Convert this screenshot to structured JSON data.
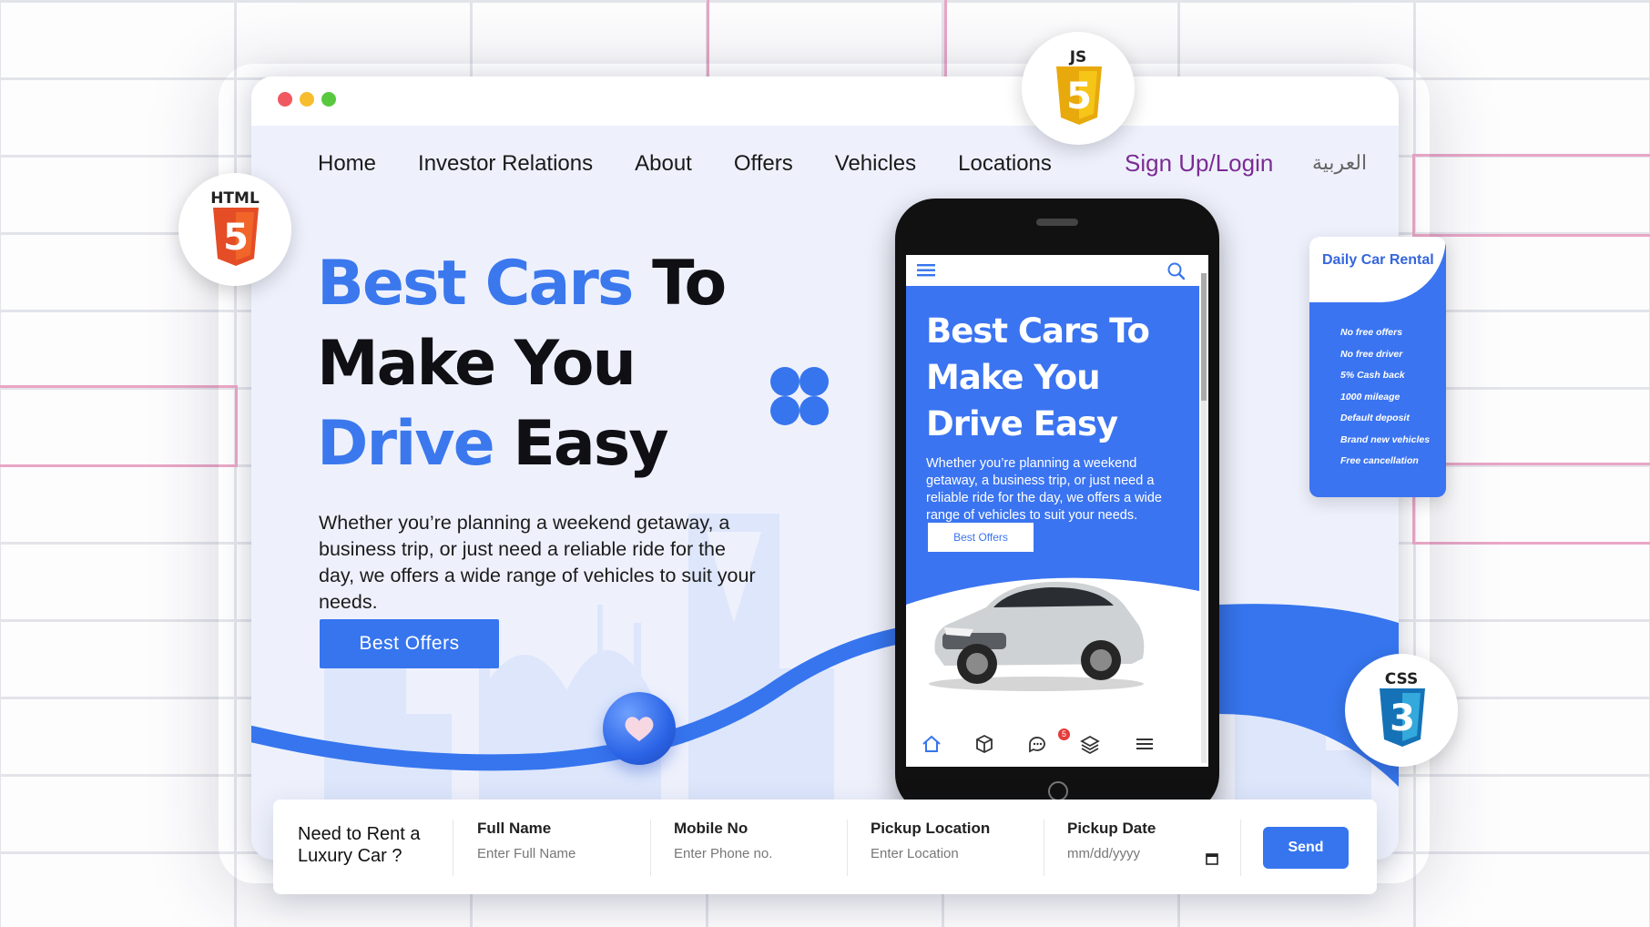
{
  "nav": {
    "items": [
      "Home",
      "Investor Relations",
      "About",
      "Offers",
      "Vehicles",
      "Locations"
    ],
    "signup": "Sign Up/Login",
    "language": "العربية"
  },
  "hero": {
    "line1_blue": "Best Cars",
    "line1_dark": "To",
    "line2": "Make You",
    "line3_blue": "Drive",
    "line3_dark": "Easy",
    "description": "Whether you’re planning a weekend getaway, a business trip, or just need a reliable ride for the day, we offers a wide range of vehicles to suit your needs.",
    "cta": "Best Offers"
  },
  "phone": {
    "title_line1": "Best Cars To",
    "title_line2": "Make You",
    "title_line3": "Drive Easy",
    "description": "Whether you’re planning a weekend getaway, a business trip, or just need a reliable ride for the day, we offers a wide range of vehicles to suit your needs.",
    "cta": "Best Offers",
    "chat_badge": "5",
    "tabs": [
      "home-icon",
      "box-icon",
      "chat-icon",
      "layers-icon",
      "menu-icon"
    ]
  },
  "rental_card": {
    "title": "Daily Car Rental",
    "items": [
      "No free offers",
      "No free driver",
      "5% Cash back",
      "1000 mileage",
      "Default deposit",
      "Brand new vehicles",
      "Free cancellation"
    ]
  },
  "logos": {
    "html": "HTML",
    "html_digit": "5",
    "js": "JS",
    "js_digit": "5",
    "css": "CSS",
    "css_digit": "3"
  },
  "form": {
    "heading": "Need to Rent a Luxury Car ?",
    "full_name_label": "Full Name",
    "full_name_placeholder": "Enter Full Name",
    "mobile_label": "Mobile No",
    "mobile_placeholder": "Enter Phone no.",
    "pickup_location_label": "Pickup Location",
    "pickup_location_placeholder": "Enter Location",
    "pickup_date_label": "Pickup Date",
    "pickup_date_placeholder": "mm/dd/yyyy",
    "send": "Send"
  },
  "colors": {
    "accent": "#3675ee",
    "signup": "#7b2c93",
    "background": "#eef1fc"
  }
}
